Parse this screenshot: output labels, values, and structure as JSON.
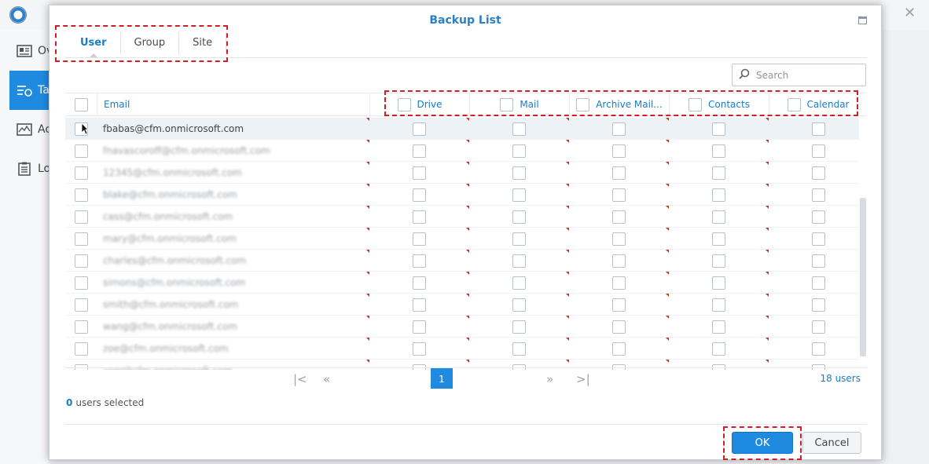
{
  "background": {
    "nav_items": [
      {
        "label": "Ov",
        "icon": "overview-icon"
      },
      {
        "label": "Ta",
        "icon": "task-icon",
        "active": true
      },
      {
        "label": "Ac",
        "icon": "activity-icon"
      },
      {
        "label": "Lo",
        "icon": "log-icon"
      }
    ]
  },
  "dialog": {
    "title": "Backup List",
    "tabs": [
      {
        "label": "User",
        "active": true
      },
      {
        "label": "Group"
      },
      {
        "label": "Site"
      }
    ],
    "search": {
      "placeholder": "Search"
    },
    "columns": {
      "email": "Email",
      "services": [
        "Drive",
        "Mail",
        "Archive Mail...",
        "Contacts",
        "Calendar"
      ]
    },
    "rows": [
      {
        "email": "fbabas@cfm.onmicrosoft.com",
        "selected": true,
        "blurred": false
      },
      {
        "email": "fnavascoroff@cfm.onmicrosoft.com",
        "blurred": true
      },
      {
        "email": "12345@cfm.onmicrosoft.com",
        "blurred": true
      },
      {
        "email": "blake@cfm.onmicrosoft.com",
        "blurred": true
      },
      {
        "email": "cass@cfm.onmicrosoft.com",
        "blurred": true
      },
      {
        "email": "mary@cfm.onmicrosoft.com",
        "blurred": true
      },
      {
        "email": "charles@cfm.onmicrosoft.com",
        "blurred": true
      },
      {
        "email": "simons@cfm.onmicrosoft.com",
        "blurred": true
      },
      {
        "email": "smith@cfm.onmicrosoft.com",
        "blurred": true
      },
      {
        "email": "wang@cfm.onmicrosoft.com",
        "blurred": true
      },
      {
        "email": "zoe@cfm.onmicrosoft.com",
        "blurred": true
      },
      {
        "email": "user@cfm.onmicrosoft.com",
        "blurred": true
      }
    ],
    "pager": {
      "current_page": "1",
      "count_label": "18 users"
    },
    "status": {
      "count": "0",
      "label": "users selected"
    },
    "buttons": {
      "ok": "OK",
      "cancel": "Cancel"
    },
    "highlight_color": "#d21f26",
    "accent_color": "#1f8be0"
  }
}
